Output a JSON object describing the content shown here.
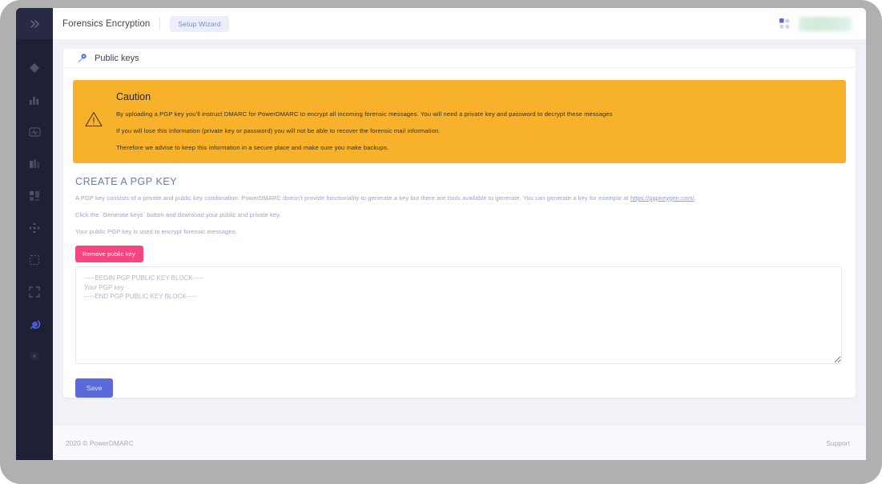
{
  "sidebar": {
    "expand_icon": "chevron-double-right-icon",
    "items": [
      {
        "icon": "diamond-icon",
        "active": false
      },
      {
        "icon": "bar-chart-icon",
        "active": false
      },
      {
        "icon": "activity-pulse-icon",
        "active": false
      },
      {
        "icon": "books-icon",
        "active": false
      },
      {
        "icon": "layout-blocks-icon",
        "active": false
      },
      {
        "icon": "move-arrows-icon",
        "active": false
      },
      {
        "icon": "dashed-square-icon",
        "active": false
      },
      {
        "icon": "fullscreen-icon",
        "active": false
      },
      {
        "icon": "key-globe-icon",
        "active": true
      },
      {
        "icon": "bolt-circle-icon",
        "active": false
      }
    ]
  },
  "topbar": {
    "title": "Forensics Encryption",
    "wizard_badge": "Setup Wizard",
    "grid_icon": "grid-apps-icon",
    "user_name": ""
  },
  "card": {
    "tab_icon": "key-icon",
    "tab_label": "Public keys"
  },
  "caution": {
    "icon": "warning-triangle-icon",
    "title": "Caution",
    "lines": [
      "By uploading a PGP key you'll instruct DMARC for PowerDMARC to encrypt all incoming forensic messages. You will need a private key and password to decrypt these messages",
      "If you will lose this information (private key or password) you will not be able to recover the forensic mail information.",
      "Therefore we advise to keep this information in a secure place and make sure you make backups."
    ],
    "color": "#f7b12a"
  },
  "pgp": {
    "heading": "CREATE A PGP KEY",
    "line1_before": "A PGP key consists of a private and public key combination. PowerDMARC doesn't provide functionality to generate a key but there are tools available to generate. You can generate a key for example at ",
    "line1_link": "https://pgpkeygen.com/",
    "line1_after": ".",
    "line2": "Click the `Generate keys` button and download your public and private key.",
    "line3": "Your public PGP key is used to encrypt forensic messages.",
    "remove_button": "Remove public key",
    "remove_button_color": "#f8447f",
    "textarea_value": "-----BEGIN PGP PUBLIC KEY BLOCK-----\nYour PGP key\n-----END PGP PUBLIC KEY BLOCK-----",
    "textarea_placeholder": "-----BEGIN PGP PUBLIC KEY BLOCK-----\nYour PGP key\n-----END PGP PUBLIC KEY BLOCK-----",
    "save_button": "Save",
    "save_button_color": "#5a6ad8"
  },
  "footer": {
    "copyright": "2020 © PowerDMARC",
    "support": "Support"
  }
}
